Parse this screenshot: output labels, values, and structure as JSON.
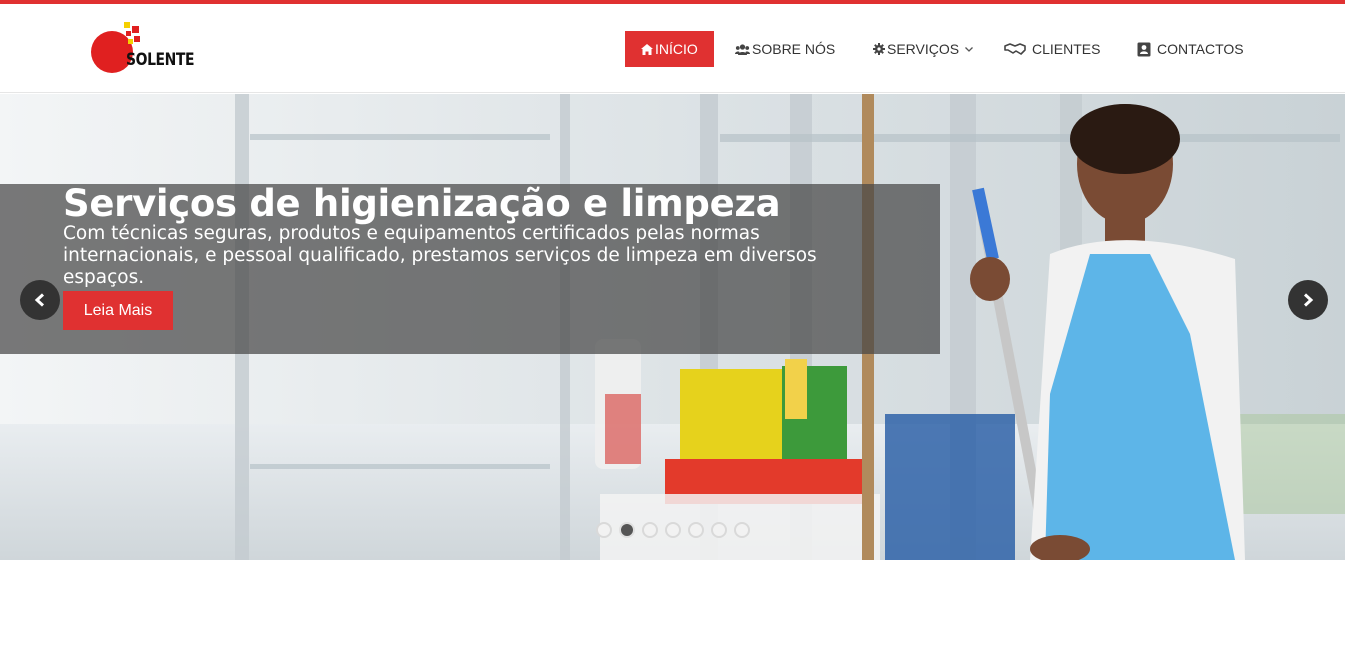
{
  "brand": {
    "name": "SOLENTE"
  },
  "nav": {
    "items": [
      {
        "label": "INÍCIO",
        "icon": "home-icon"
      },
      {
        "label": "SOBRE NÓS",
        "icon": "users-icon"
      },
      {
        "label": "SERVIÇOS",
        "icon": "gear-icon"
      },
      {
        "label": "CLIENTES",
        "icon": "handshake-icon"
      },
      {
        "label": "CONTACTOS",
        "icon": "contact-card-icon"
      }
    ]
  },
  "slider": {
    "title": "Serviços de higienização e limpeza",
    "text": "Com técnicas seguras, produtos e equipamentos certificados pelas normas internacionais, e pessoal qualificado, prestamos serviços de limpeza em diversos espaços.",
    "button": "Leia Mais",
    "slide_count": 7,
    "active_slide": 2
  },
  "colors": {
    "accent": "#e03131",
    "topbar": "#e03131"
  }
}
